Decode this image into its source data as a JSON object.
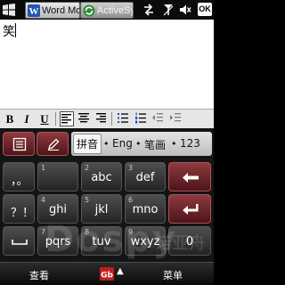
{
  "taskbar": {
    "tabs": [
      {
        "label": "Word Mo"
      },
      {
        "label": "ActiveSy"
      }
    ],
    "ok_label": "OK",
    "icons": [
      "windows-start-icon",
      "word-icon",
      "activesync-icon",
      "sync-arrows-icon",
      "signal-icon",
      "volume-muted-icon"
    ]
  },
  "document": {
    "text": "笑"
  },
  "toolbar": {
    "bold": "B",
    "italic": "I",
    "underline": "U"
  },
  "keyboard": {
    "modes": {
      "pinyin": "拼音",
      "english": "Eng",
      "stroke": "笔画",
      "numeric": "123",
      "separator": "•"
    },
    "rows": [
      [
        {
          "num": "",
          "label": "，。"
        },
        {
          "num": "1",
          "label": ""
        },
        {
          "num": "2",
          "label": "abc"
        },
        {
          "num": "3",
          "label": "def"
        }
      ],
      [
        {
          "num": "",
          "label": "？！"
        },
        {
          "num": "4",
          "label": "ghi"
        },
        {
          "num": "5",
          "label": "jkl"
        },
        {
          "num": "6",
          "label": "mno"
        }
      ],
      [
        {
          "num": "",
          "label": ""
        },
        {
          "num": "7",
          "label": "pqrs"
        },
        {
          "num": "8",
          "label": "tuv"
        },
        {
          "num": "9",
          "label": "wxyz"
        },
        {
          "num": "",
          "label": "0"
        }
      ]
    ]
  },
  "softkeys": {
    "left": "查看",
    "right": "菜单"
  },
  "watermark": {
    "brand": "Dospy",
    "text": "诺亚舟"
  },
  "colors": {
    "accent_red": "#8e3a3e",
    "key_dark": "#2f2f2f",
    "sip_red": "#c11d1d"
  }
}
